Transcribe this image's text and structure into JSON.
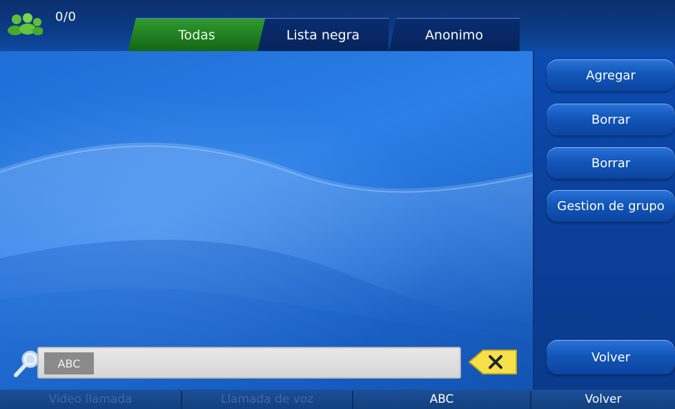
{
  "header": {
    "count": "0/0",
    "group_icon": "contacts-group-icon"
  },
  "tabs": [
    {
      "label": "Todas",
      "active": true
    },
    {
      "label": "Lista negra",
      "active": false
    },
    {
      "label": "Anonimo",
      "active": false
    }
  ],
  "sidebar": {
    "buttons": [
      {
        "label": "Agregar"
      },
      {
        "label": "Borrar"
      },
      {
        "label": "Borrar"
      },
      {
        "label": "Gestion de grupo"
      }
    ],
    "back_label": "Volver"
  },
  "search": {
    "icon": "search-icon",
    "input_mode": "ABC",
    "value": "",
    "clear_icon": "clear-icon"
  },
  "softkeys": [
    {
      "label": "Video llamada",
      "enabled": false
    },
    {
      "label": "Llamada de voz",
      "enabled": false
    },
    {
      "label": "ABC",
      "enabled": true
    },
    {
      "label": "Volver",
      "enabled": true
    }
  ],
  "colors": {
    "active_tab": "#1f7a1f",
    "button_blue": "#1256b8",
    "background": "#2b7fe6"
  }
}
